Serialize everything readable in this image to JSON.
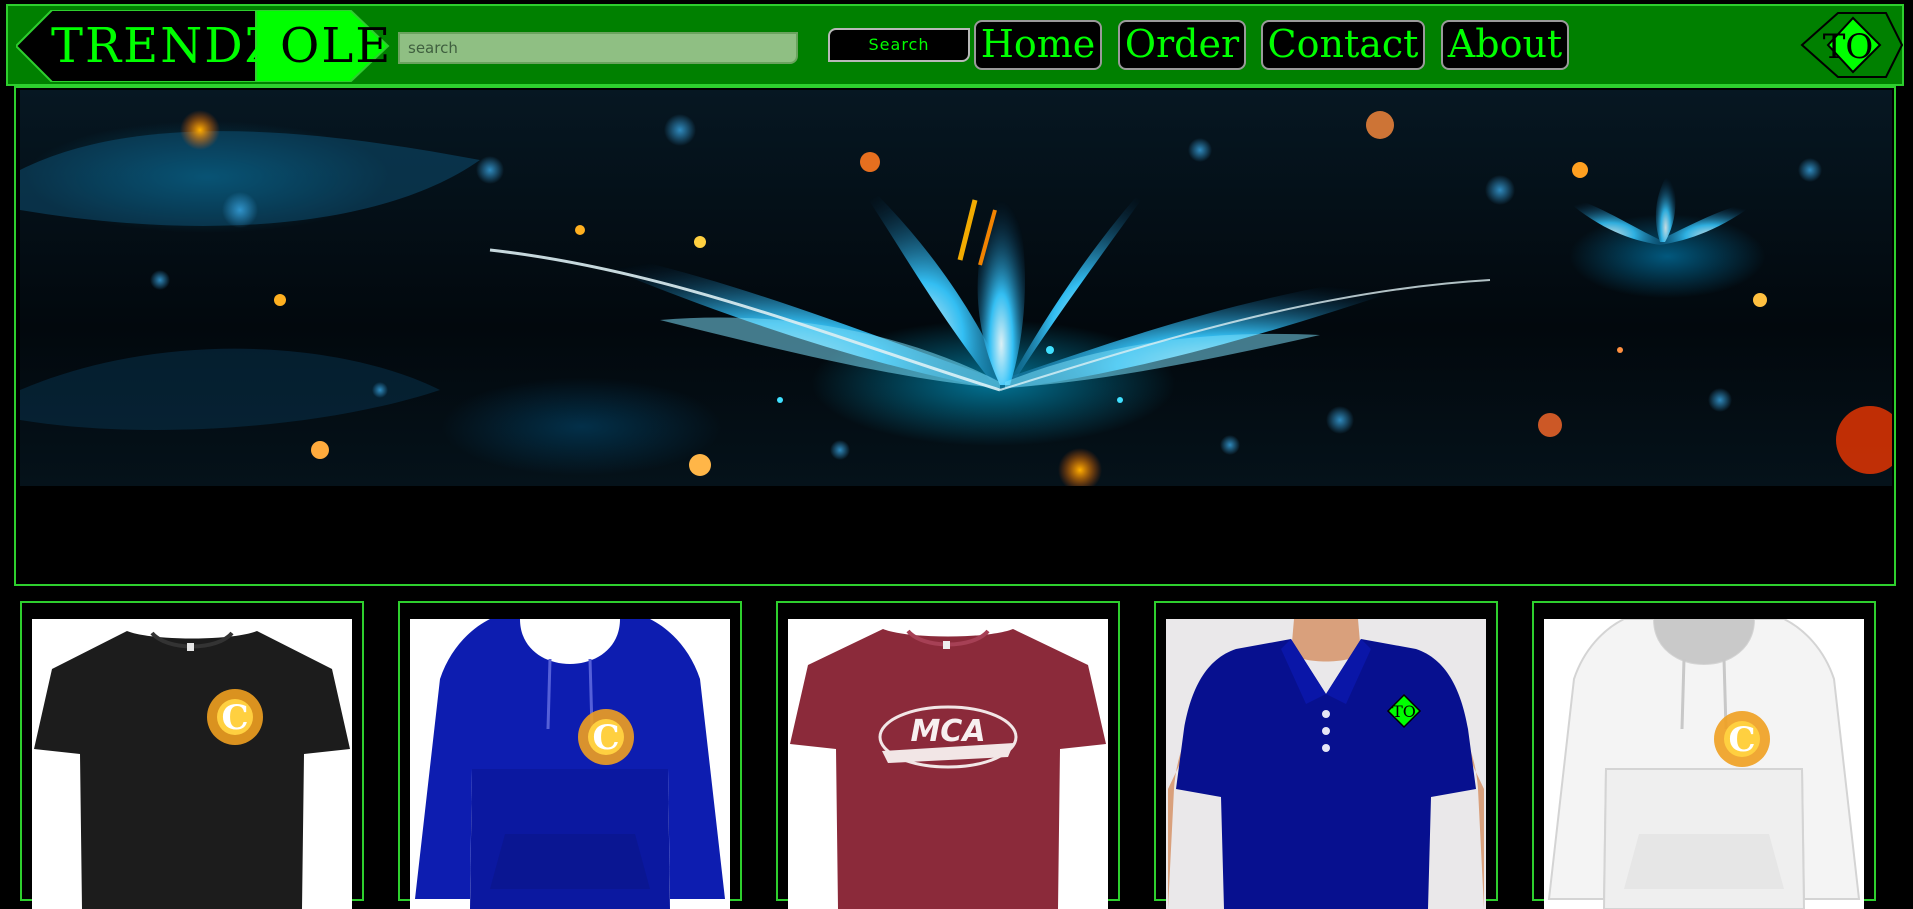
{
  "header": {
    "logo_text_main": "TRENDZ",
    "logo_text_accent": "OLE",
    "corner_logo_text": "TO"
  },
  "search": {
    "placeholder": "search",
    "button_label": "Search"
  },
  "nav": [
    {
      "label": "Home"
    },
    {
      "label": "Order"
    },
    {
      "label": "Contact"
    },
    {
      "label": "About"
    }
  ],
  "products": [
    {
      "type": "tshirt",
      "color": "#1c1c1c",
      "background": "#ffffff",
      "print": "C-flame-logo"
    },
    {
      "type": "hoodie",
      "color": "#0d1db0",
      "background": "#ffffff",
      "print": "C-flame-logo"
    },
    {
      "type": "tshirt",
      "color": "#8b2a3a",
      "background": "#ffffff",
      "print": "MCA",
      "print_text": "MCA"
    },
    {
      "type": "polo",
      "color": "#07108f",
      "background": "#eae8ea",
      "print": "TO-logo",
      "print_text": "TO"
    },
    {
      "type": "hoodie",
      "color": "#f4f4f4",
      "background": "#ffffff",
      "print": "C-flame-logo"
    }
  ],
  "colors": {
    "header_bg": "#008000",
    "accent_green": "#00ff00",
    "border_green": "#2ecf2e",
    "page_bg": "#000000"
  }
}
